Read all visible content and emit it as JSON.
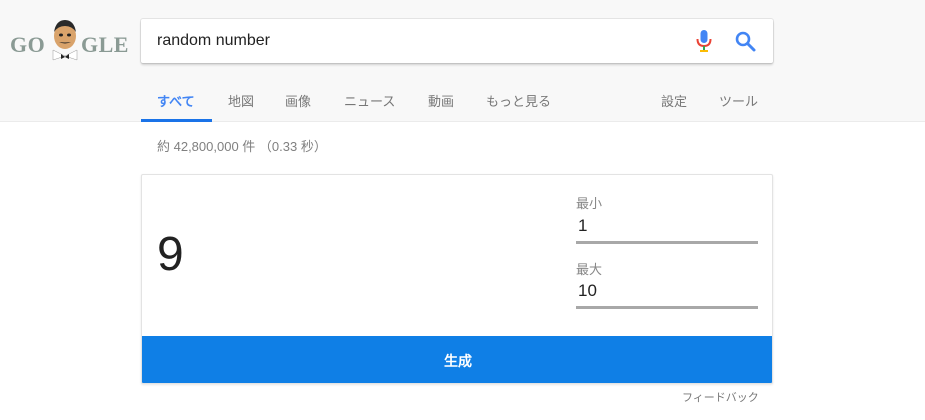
{
  "logo": {
    "left_text": "GO",
    "right_text": "GLE"
  },
  "search": {
    "query": "random number"
  },
  "tabs": [
    {
      "label": "すべて",
      "active": true
    },
    {
      "label": "地図"
    },
    {
      "label": "画像"
    },
    {
      "label": "ニュース"
    },
    {
      "label": "動画"
    },
    {
      "label": "もっと見る"
    }
  ],
  "tools": {
    "settings": "設定",
    "tools": "ツール"
  },
  "results_count": "約 42,800,000 件 （0.33 秒）",
  "rng": {
    "result": "9",
    "min_label": "最小",
    "min_value": "1",
    "max_label": "最大",
    "max_value": "10",
    "generate_label": "生成"
  },
  "feedback": "フィードバック",
  "colors": {
    "accent": "#4285f4",
    "button": "#0f7fe6"
  },
  "icons": {
    "mic": "microphone-icon",
    "search": "magnifier-icon"
  }
}
